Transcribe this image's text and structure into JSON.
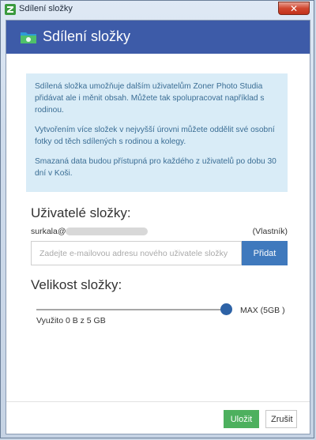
{
  "window": {
    "title": "Sdílení složky",
    "close_glyph": "✕",
    "icon": "zoner-app-icon"
  },
  "header": {
    "title": "Sdílení složky",
    "icon": "shared-folder-icon",
    "color": "#3d5ba8"
  },
  "info": {
    "paragraphs": [
      "Sdílená složka umožňuje dalším uživatelům Zoner Photo Studia přidávat ale i měnit obsah. Můžete tak spolupracovat například s rodinou.",
      "Vytvořením více složek v nejvyšší úrovni můžete oddělit své osobní fotky od těch sdílených s rodinou a kolegy.",
      "Smazaná data budou přístupná pro každého z uživatelů po dobu 30 dní v Koši."
    ]
  },
  "users": {
    "heading": "Uživatelé složky:",
    "owner_email_prefix": "surkala@",
    "owner_role": "(Vlastník)",
    "email_placeholder": "Zadejte e-mailovou adresu nového uživatele složky",
    "email_value": "",
    "add_label": "Přidat"
  },
  "size": {
    "heading": "Velikost složky:",
    "slider_level": 1.0,
    "max_label": "MAX (5GB )",
    "usage_text": "Využito 0 B z 5 GB"
  },
  "footer": {
    "save_label": "Uložit",
    "cancel_label": "Zrušit"
  },
  "colors": {
    "accent_blue": "#3f79bd",
    "save_green": "#4db05e",
    "info_bg": "#d9ecf7",
    "info_text": "#3a6d94"
  }
}
